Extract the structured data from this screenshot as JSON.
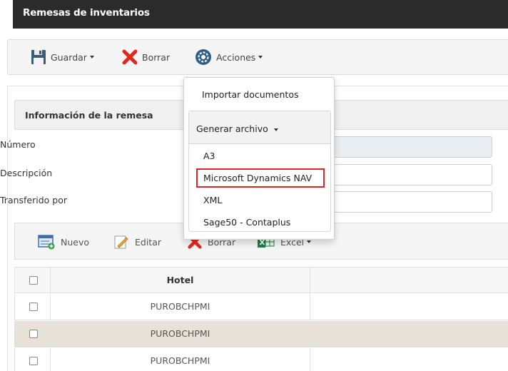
{
  "window": {
    "title": "Remesas de inventarios"
  },
  "toolbar": {
    "save_label": "Guardar",
    "delete_label": "Borrar",
    "actions_label": "Acciones"
  },
  "actions_menu": {
    "import_label": "Importar documentos",
    "generate_label": "Generar archivo",
    "generate_items": [
      "A3",
      "Microsoft Dynamics NAV",
      "XML",
      "Sage50 - Contaplus"
    ],
    "highlighted_item": "Microsoft Dynamics NAV",
    "highlight_color": "#d9262a"
  },
  "section": {
    "title": "Información de la remesa"
  },
  "fields": {
    "numero_label": "Número",
    "descripcion_label": "Descripción",
    "transferido_label": "Transferido por"
  },
  "grid_toolbar": {
    "new_label": "Nuevo",
    "edit_label": "Editar",
    "delete_label": "Borrar",
    "excel_label": "Excel"
  },
  "grid": {
    "header_hotel": "Hotel",
    "rows": [
      "PUROBCHPMI",
      "PUROBCHPMI",
      "PUROBCHPMI"
    ],
    "selected_row_color": "#e8e1d8"
  }
}
